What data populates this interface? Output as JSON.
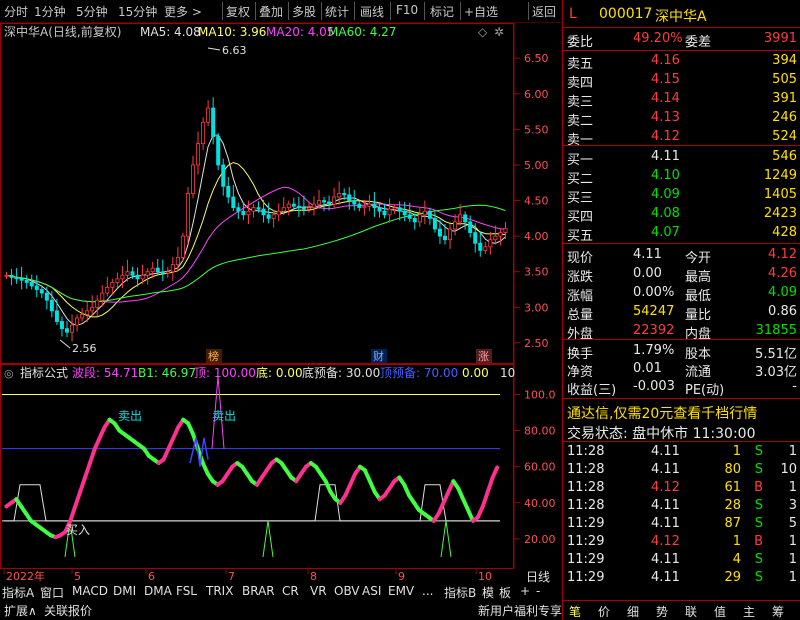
{
  "toolbar": {
    "items": [
      "分时",
      "1分钟",
      "5分钟",
      "15分钟",
      "更多 >",
      "复权",
      "叠加",
      "多股",
      "统计",
      "画线",
      "F10",
      "标记",
      "+自选",
      "返回"
    ]
  },
  "chart_header": {
    "stock_title": "深中华A(日线,前复权)",
    "ma5": "MA5: 4.08",
    "ma10": "MA10: 3.96",
    "ma20": "MA20: 4.05",
    "ma60": "MA60: 4.27",
    "colors": {
      "ma5": "#e0e0e0",
      "ma10": "#ffff60",
      "ma20": "#ff40ff",
      "ma60": "#40ff40"
    }
  },
  "chart_data": [
    {
      "type": "candlestick",
      "title": "深中华A(日线,前复权)",
      "y_ticks": [
        "6.50",
        "6.00",
        "5.50",
        "5.00",
        "4.50",
        "4.00",
        "3.50",
        "3.00",
        "2.50"
      ],
      "ylim": [
        2.4,
        6.7
      ],
      "annotations": {
        "high": "6.63",
        "low": "2.56"
      },
      "events": [
        "榜",
        "财",
        "涨"
      ],
      "x_ticks": [
        "2022年",
        "5",
        "6",
        "7",
        "8",
        "9",
        "10"
      ],
      "close": [
        3.45,
        3.42,
        3.4,
        3.38,
        3.35,
        3.3,
        3.25,
        3.2,
        3.1,
        2.95,
        2.8,
        2.7,
        2.65,
        2.75,
        2.85,
        2.9,
        2.95,
        3.0,
        3.1,
        3.2,
        3.28,
        3.35,
        3.4,
        3.45,
        3.5,
        3.45,
        3.4,
        3.45,
        3.5,
        3.55,
        3.5,
        3.48,
        3.5,
        3.6,
        3.7,
        4.0,
        4.6,
        5.0,
        5.3,
        5.6,
        5.8,
        5.4,
        5.0,
        4.7,
        4.55,
        4.4,
        4.35,
        4.3,
        4.35,
        4.4,
        4.38,
        4.3,
        4.25,
        4.3,
        4.35,
        4.4,
        4.45,
        4.42,
        4.4,
        4.38,
        4.4,
        4.45,
        4.5,
        4.48,
        4.45,
        4.55,
        4.6,
        4.58,
        4.5,
        4.45,
        4.4,
        4.42,
        4.45,
        4.4,
        4.35,
        4.3,
        4.38,
        4.4,
        4.35,
        4.3,
        4.25,
        4.2,
        4.3,
        4.35,
        4.25,
        4.1,
        4.0,
        3.95,
        4.1,
        4.2,
        4.3,
        4.2,
        4.05,
        3.9,
        3.8,
        3.85,
        3.95,
        4.0,
        4.05,
        4.11
      ]
    },
    {
      "type": "line",
      "title": "指标公式",
      "series_labels": {
        "wave": "波段: 54.71",
        "b1": "B1: 46.97",
        "top": "顶: 100.00",
        "bottom": "底: 0.00",
        "bottom_warn": "底预备: 30.00",
        "top_warn": "顶预备: 70.00",
        "zero": "0.00",
        "ten": "10"
      },
      "y_ticks": [
        "100.0",
        "80.00",
        "60.00",
        "40.00",
        "20.00"
      ],
      "ylim": [
        5,
        108
      ],
      "signals": [
        "卖出",
        "卖出",
        "买入"
      ],
      "wave": [
        38,
        40,
        42,
        38,
        34,
        30,
        28,
        26,
        24,
        22,
        21,
        22,
        24,
        30,
        38,
        46,
        54,
        62,
        70,
        76,
        82,
        86,
        84,
        80,
        78,
        76,
        74,
        72,
        70,
        66,
        64,
        62,
        64,
        70,
        76,
        82,
        86,
        84,
        78,
        70,
        62,
        56,
        52,
        50,
        52,
        56,
        60,
        62,
        60,
        56,
        52,
        50,
        54,
        58,
        62,
        64,
        62,
        58,
        54,
        52,
        56,
        60,
        62,
        60,
        56,
        52,
        46,
        42,
        40,
        44,
        50,
        56,
        60,
        58,
        52,
        46,
        42,
        44,
        48,
        52,
        54,
        50,
        44,
        40,
        36,
        34,
        32,
        30,
        34,
        40,
        46,
        52,
        48,
        42,
        36,
        30,
        32,
        38,
        46,
        54,
        60
      ]
    }
  ],
  "quote": {
    "code": "000017",
    "name": "深中华A",
    "marker": "L",
    "webi_label": "委比",
    "webi_value": "49.20%",
    "weicha_label": "委差",
    "weicha_value": "3991",
    "asks": [
      {
        "label": "卖五",
        "price": "4.16",
        "vol": "394"
      },
      {
        "label": "卖四",
        "price": "4.15",
        "vol": "505"
      },
      {
        "label": "卖三",
        "price": "4.14",
        "vol": "391"
      },
      {
        "label": "卖二",
        "price": "4.13",
        "vol": "246"
      },
      {
        "label": "卖一",
        "price": "4.12",
        "vol": "524"
      }
    ],
    "bids": [
      {
        "label": "买一",
        "price": "4.11",
        "vol": "546"
      },
      {
        "label": "买二",
        "price": "4.10",
        "vol": "1249"
      },
      {
        "label": "买三",
        "price": "4.09",
        "vol": "1405"
      },
      {
        "label": "买四",
        "price": "4.08",
        "vol": "2423"
      },
      {
        "label": "买五",
        "price": "4.07",
        "vol": "428"
      }
    ],
    "stats": [
      {
        "l1": "现价",
        "v1": "4.11",
        "l2": "今开",
        "v2": "4.12"
      },
      {
        "l1": "涨跌",
        "v1": "0.00",
        "l2": "最高",
        "v2": "4.26"
      },
      {
        "l1": "涨幅",
        "v1": "0.00%",
        "l2": "最低",
        "v2": "4.09"
      },
      {
        "l1": "总量",
        "v1": "54247",
        "l2": "量比",
        "v2": "0.86"
      },
      {
        "l1": "外盘",
        "v1": "22392",
        "l2": "内盘",
        "v2": "31855"
      }
    ],
    "stats2": [
      {
        "l1": "换手",
        "v1": "1.79%",
        "l2": "股本",
        "v2": "5.51亿"
      },
      {
        "l1": "净资",
        "v1": "0.01",
        "l2": "流通",
        "v2": "3.03亿"
      },
      {
        "l1": "收益(三)",
        "v1": "-0.003",
        "l2": "PE(动)",
        "v2": "-"
      }
    ],
    "promo": "通达信,仅需20元查看千档行情",
    "trade_status": "交易状态: 盘中休市 11:30:00",
    "ticks": [
      {
        "t": "11:28",
        "p": "4.11",
        "v": "1",
        "s": "S"
      },
      {
        "t": "11:28",
        "p": "4.11",
        "v": "80",
        "s": "S"
      },
      {
        "t": "11:28",
        "p": "4.12",
        "v": "61",
        "s": "B"
      },
      {
        "t": "11:28",
        "p": "4.11",
        "v": "28",
        "s": "S"
      },
      {
        "t": "11:29",
        "p": "4.11",
        "v": "87",
        "s": "S"
      },
      {
        "t": "11:29",
        "p": "4.12",
        "v": "1",
        "s": "B"
      },
      {
        "t": "11:29",
        "p": "4.11",
        "v": "4",
        "s": "S"
      },
      {
        "t": "11:29",
        "p": "4.11",
        "v": "29",
        "s": "S"
      }
    ],
    "tick_counts": [
      "1",
      "10",
      "1",
      "3",
      "5",
      "1",
      "1",
      "1"
    ],
    "bottom_tabs": [
      "笔",
      "价",
      "细",
      "势",
      "联",
      "值",
      "主",
      "筹"
    ]
  },
  "bottom": {
    "indicator_tabs": [
      "指标A",
      "窗口",
      "MACD",
      "DMI",
      "DMA",
      "FSL",
      "TRIX",
      "BRAR",
      "CR",
      "VR",
      "OBV",
      "ASI",
      "EMV",
      "...",
      "指标B",
      "模",
      "板",
      "+",
      "-",
      "日线"
    ],
    "bottom_row": [
      "扩展∧",
      "关联报价"
    ],
    "promo": "新用户福利专享"
  }
}
